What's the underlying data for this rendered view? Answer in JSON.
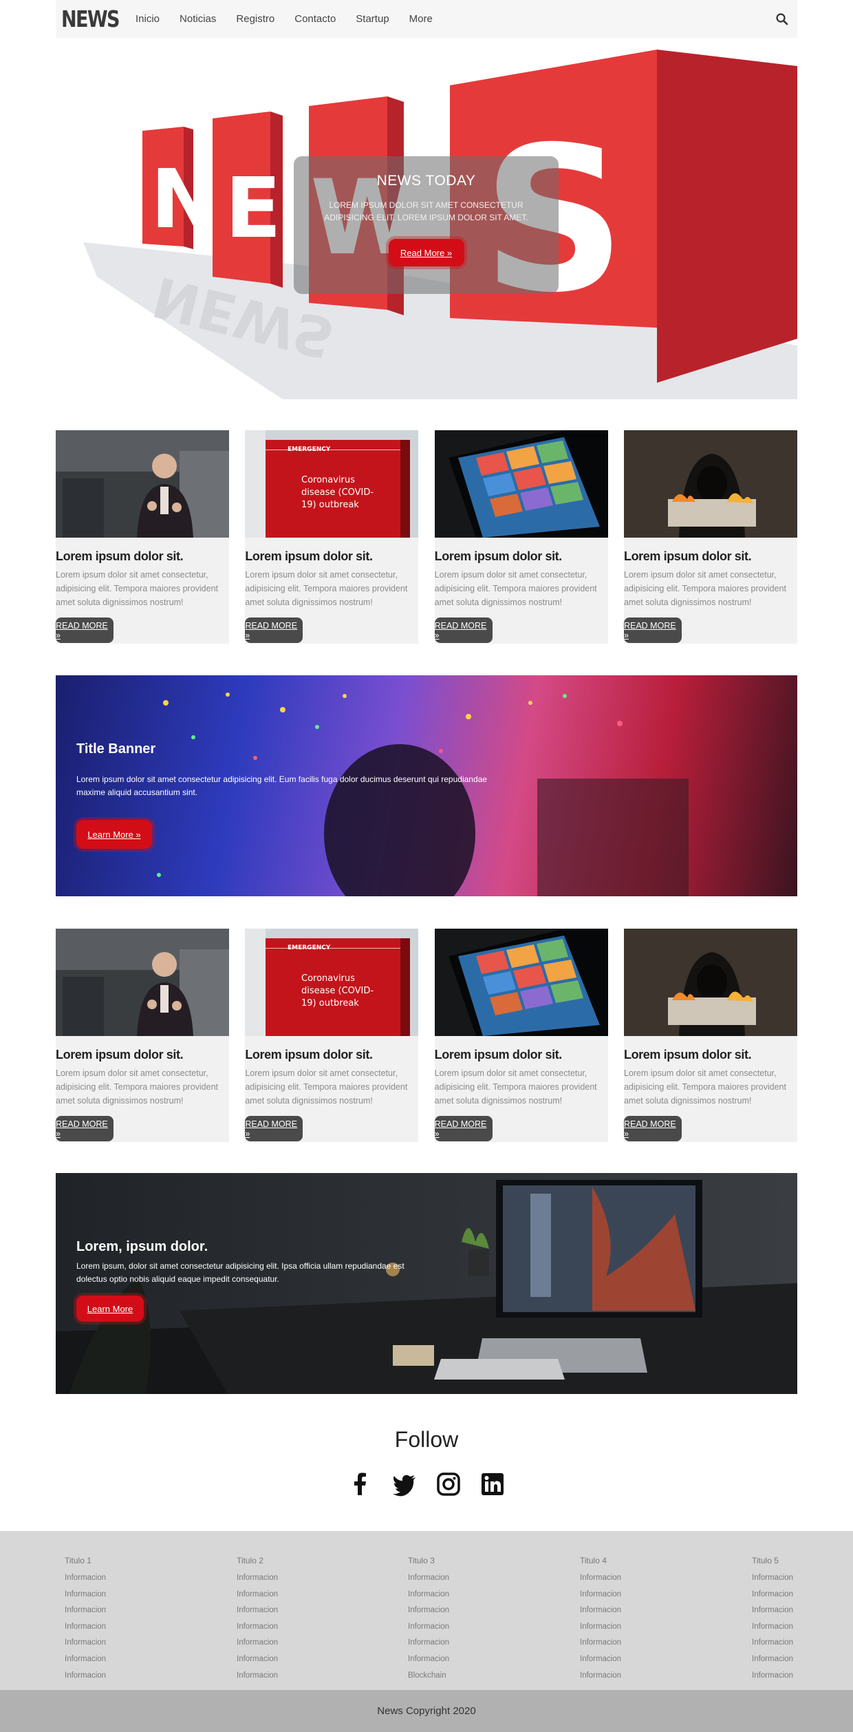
{
  "nav": {
    "brand": "NEWS",
    "links": [
      "Inicio",
      "Noticias",
      "Registro",
      "Contacto",
      "Startup",
      "More"
    ]
  },
  "hero": {
    "title": "NEWS TODAY",
    "text": "LOREM IPSUM DOLOR SIT AMET CONSECTETUR ADIPISICING ELIT. LOREM IPSUM DOLOR SIT AMET.",
    "button": "Read More »",
    "image_letters": [
      "N",
      "E",
      "W",
      "S"
    ]
  },
  "cards_top": [
    {
      "title": "Lorem ipsum dolor sit.",
      "text": "Lorem ipsum dolor sit amet consectetur, adipisicing elit. Tempora maiores provident amet soluta dignissimos nostrum!",
      "button": "READ MORE »"
    },
    {
      "title": "Lorem ipsum dolor sit.",
      "text": "Lorem ipsum dolor sit amet consectetur, adipisicing elit. Tempora maiores provident amet soluta dignissimos nostrum!",
      "button": "READ MORE »",
      "image_label": "EMERGENCY",
      "image_caption": "Coronavirus disease (COVID-19) outbreak"
    },
    {
      "title": "Lorem ipsum dolor sit.",
      "text": "Lorem ipsum dolor sit amet consectetur, adipisicing elit. Tempora maiores provident amet soluta dignissimos nostrum!",
      "button": "READ MORE »"
    },
    {
      "title": "Lorem ipsum dolor sit.",
      "text": "Lorem ipsum dolor sit amet consectetur, adipisicing elit. Tempora maiores provident amet soluta dignissimos nostrum!",
      "button": "READ MORE »"
    }
  ],
  "banner1": {
    "title": "Title Banner",
    "text": "Lorem ipsum dolor sit amet consectetur adipisicing elit. Eum facilis fuga dolor ducimus deserunt qui repudiandae maxime aliquid accusantium sint.",
    "button": "Learn More »"
  },
  "cards_bottom": [
    {
      "title": "Lorem ipsum dolor sit.",
      "text": "Lorem ipsum dolor sit amet consectetur, adipisicing elit. Tempora maiores provident amet soluta dignissimos nostrum!",
      "button": "READ MORE »"
    },
    {
      "title": "Lorem ipsum dolor sit.",
      "text": "Lorem ipsum dolor sit amet consectetur, adipisicing elit. Tempora maiores provident amet soluta dignissimos nostrum!",
      "button": "READ MORE »",
      "image_label": "EMERGENCY",
      "image_caption": "Coronavirus disease (COVID-19) outbreak"
    },
    {
      "title": "Lorem ipsum dolor sit.",
      "text": "Lorem ipsum dolor sit amet consectetur, adipisicing elit. Tempora maiores provident amet soluta dignissimos nostrum!",
      "button": "READ MORE »"
    },
    {
      "title": "Lorem ipsum dolor sit.",
      "text": "Lorem ipsum dolor sit amet consectetur, adipisicing elit. Tempora maiores provident amet soluta dignissimos nostrum!",
      "button": "READ MORE »"
    }
  ],
  "banner2": {
    "title": "Lorem, ipsum dolor.",
    "text": "Lorem ipsum, dolor sit amet consectetur adipisicing elit. Ipsa officia ullam repudiandae est dolectus optio nobis aliquid eaque impedit consequatur.",
    "button": "Learn More"
  },
  "follow": {
    "title": "Follow",
    "icons": [
      "facebook-icon",
      "twitter-icon",
      "instagram-icon",
      "linkedin-icon"
    ]
  },
  "footer": {
    "columns": [
      {
        "title": "Titulo 1",
        "items": [
          "Informacion",
          "Informacion",
          "Informacion",
          "Informacion",
          "Informacion",
          "Informacion",
          "Informacion"
        ]
      },
      {
        "title": "Titulo 2",
        "items": [
          "Informacion",
          "Informacion",
          "Informacion",
          "Informacion",
          "Informacion",
          "Informacion",
          "Informacion"
        ]
      },
      {
        "title": "Titulo 3",
        "items": [
          "Informacion",
          "Informacion",
          "Informacion",
          "Informacion",
          "Informacion",
          "Informacion",
          "Blockchain"
        ]
      },
      {
        "title": "Titulo 4",
        "items": [
          "Informacion",
          "Informacion",
          "Informacion",
          "Informacion",
          "Informacion",
          "Informacion",
          "Informacion"
        ]
      },
      {
        "title": "Titulo 5",
        "items": [
          "Informacion",
          "Informacion",
          "Informacion",
          "Informacion",
          "Informacion",
          "Informacion",
          "Informacion"
        ]
      }
    ],
    "copyright": "News Copyright 2020"
  },
  "colors": {
    "accent_red": "#d30d17",
    "nav_bg": "#f6f6f6",
    "card_bg": "#f1f1f1",
    "card_button": "#4a4a4a",
    "footer_bg": "#d7d7d7",
    "copyright_bg": "#b1b1b1"
  }
}
